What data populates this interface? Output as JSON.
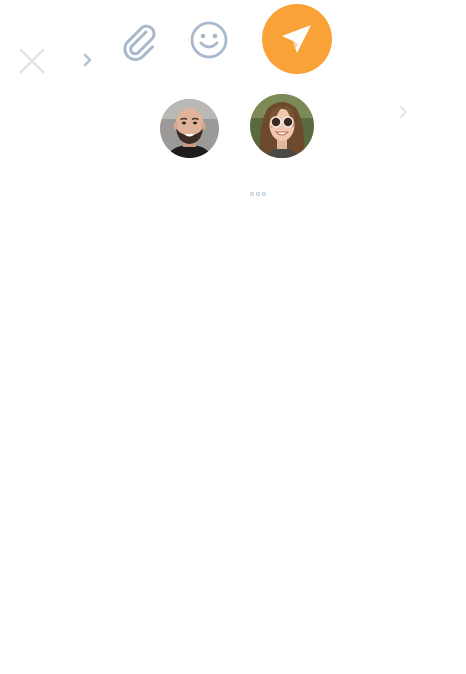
{
  "toolbar": {
    "close_icon": "close-icon",
    "left_chevron_icon": "chevron-right-icon",
    "attach_icon": "paperclip-icon",
    "emoji_icon": "smiley-icon",
    "send_icon": "paper-plane-icon"
  },
  "recipients": {
    "items": [
      {
        "icon": "avatar-bald-bearded-man"
      },
      {
        "icon": "avatar-woman-sunglasses"
      }
    ],
    "next_icon": "chevron-right-icon"
  },
  "typing_indicator": {
    "dots": 3
  },
  "colors": {
    "icon_muted": "#a9b9cc",
    "icon_faint": "#dde4ec",
    "accent": "#f9a237",
    "send_icon": "#ffffff",
    "background": "#ffffff"
  }
}
